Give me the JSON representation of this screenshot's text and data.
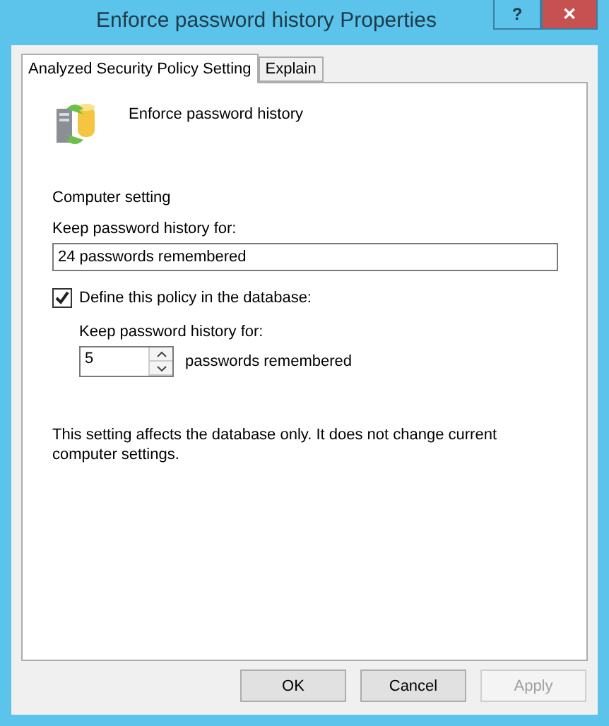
{
  "window": {
    "title": "Enforce password history Properties",
    "help": "?",
    "close": "✕"
  },
  "tabs": [
    {
      "label": "Analyzed Security Policy Setting",
      "selected": true
    },
    {
      "label": "Explain",
      "selected": false
    }
  ],
  "policy": {
    "name": "Enforce password history"
  },
  "computer_setting": {
    "heading": "Computer setting",
    "label": "Keep password history for:",
    "value": "24 passwords remembered"
  },
  "define": {
    "label": "Define this policy in the database:",
    "checked": true,
    "field_label": "Keep password history for:",
    "value": "5",
    "unit": "passwords remembered"
  },
  "note": "This setting affects the database only. It does not change current computer settings.",
  "buttons": [
    {
      "label": "OK",
      "disabled": false
    },
    {
      "label": "Cancel",
      "disabled": false
    },
    {
      "label": "Apply",
      "disabled": true
    }
  ]
}
